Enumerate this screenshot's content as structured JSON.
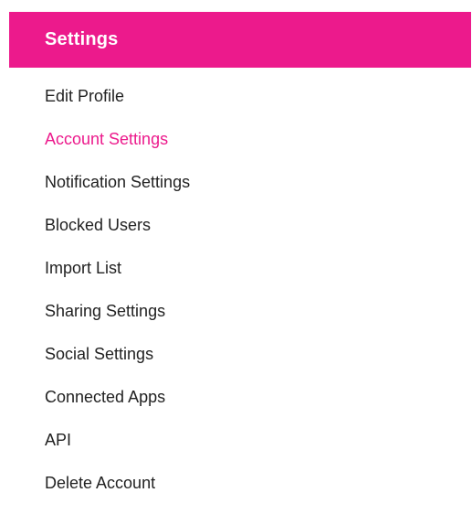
{
  "header": {
    "title": "Settings"
  },
  "colors": {
    "accent": "#ec1a8c",
    "text": "#222222",
    "header_text": "#ffffff"
  },
  "menu": {
    "active_index": 1,
    "items": [
      {
        "label": "Edit Profile"
      },
      {
        "label": "Account Settings"
      },
      {
        "label": "Notification Settings"
      },
      {
        "label": "Blocked Users"
      },
      {
        "label": "Import List"
      },
      {
        "label": "Sharing Settings"
      },
      {
        "label": "Social Settings"
      },
      {
        "label": "Connected Apps"
      },
      {
        "label": "API"
      },
      {
        "label": "Delete Account"
      }
    ]
  }
}
